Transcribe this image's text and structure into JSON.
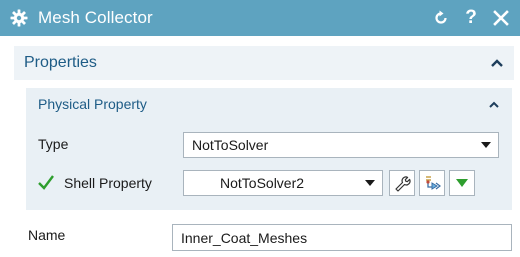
{
  "window": {
    "title": "Mesh Collector",
    "help_label": "?",
    "reset_icon": "reset-icon",
    "close_icon": "close-icon",
    "app_icon": "gear-icon"
  },
  "properties": {
    "header": "Properties",
    "physical_property": {
      "header": "Physical Property",
      "type_label": "Type",
      "type_value": "NotToSolver",
      "shell_label": "Shell Property",
      "shell_status_icon": "checkmark-icon",
      "shell_value": "NotToSolver2",
      "tools": [
        "wrench-icon",
        "inherit-property-icon",
        "expand-down-icon"
      ]
    },
    "name_label": "Name",
    "name_value": "Inner_Coat_Meshes"
  },
  "colors": {
    "titlebar": "#5ea3c0",
    "header_text": "#1e5c86",
    "check": "#2e9e2e",
    "dropdown_arrow": "#2e9e2e"
  }
}
